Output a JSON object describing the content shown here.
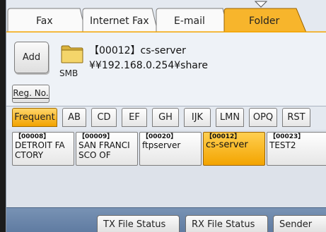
{
  "tabs": [
    {
      "label": "Fax"
    },
    {
      "label": "Internet Fax"
    },
    {
      "label": "E-mail"
    },
    {
      "label": "Folder",
      "selected": true
    }
  ],
  "destination": {
    "add_label": "Add",
    "protocol": "SMB",
    "name": "【00012】cs-server",
    "path": "¥¥192.168.0.254¥share"
  },
  "reg_no_label": "Reg. No.",
  "index_tabs": [
    {
      "label": "Frequent",
      "selected": true
    },
    {
      "label": "AB"
    },
    {
      "label": "CD"
    },
    {
      "label": "EF"
    },
    {
      "label": "GH"
    },
    {
      "label": "IJK"
    },
    {
      "label": "LMN"
    },
    {
      "label": "OPQ"
    },
    {
      "label": "RST"
    }
  ],
  "entries": [
    {
      "number": "【00008】",
      "line1": "DETROIT FA",
      "line2": "CTORY"
    },
    {
      "number": "【00009】",
      "line1": "SAN FRANCI",
      "line2": "SCO OF"
    },
    {
      "number": "【00020】",
      "line1": "ftpserver",
      "line2": ""
    },
    {
      "number": "【00012】",
      "line1": "cs-server",
      "line2": "",
      "selected": true
    },
    {
      "number": "【00023】",
      "line1": "TEST2",
      "line2": ""
    }
  ],
  "bottom_buttons": [
    {
      "label": "TX File Status"
    },
    {
      "label": "RX File Status"
    },
    {
      "label": "Sender"
    }
  ],
  "colors": {
    "accent_orange": "#f3a400",
    "panel_bg": "#eef2f7",
    "bottom_bar": "#6b86ab"
  }
}
